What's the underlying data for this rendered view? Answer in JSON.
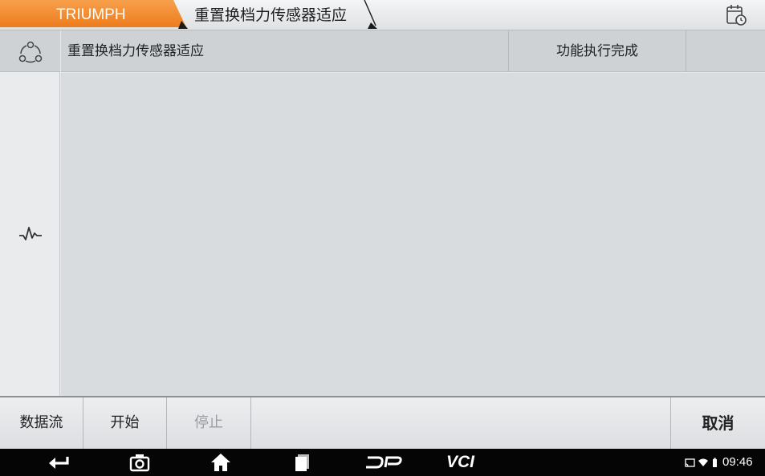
{
  "breadcrumb": {
    "brand": "TRIUMPH",
    "title": "重置换档力传感器适应"
  },
  "header": {
    "function_name": "重置换档力传感器适应",
    "status": "功能执行完成"
  },
  "actions": {
    "data_stream": "数据流",
    "start": "开始",
    "stop": "停止",
    "cancel": "取消"
  },
  "navbar": {
    "vci_label": "VCI",
    "time": "09:46"
  },
  "colors": {
    "brand_orange": "#f28a2e",
    "nav_background": "#050505"
  },
  "icons": [
    "calendar-icon",
    "share-icon",
    "waveform-icon",
    "back-icon",
    "camera-icon",
    "home-icon",
    "recents-icon",
    "dp-logo-icon",
    "cast-icon",
    "wifi-icon",
    "battery-icon"
  ]
}
